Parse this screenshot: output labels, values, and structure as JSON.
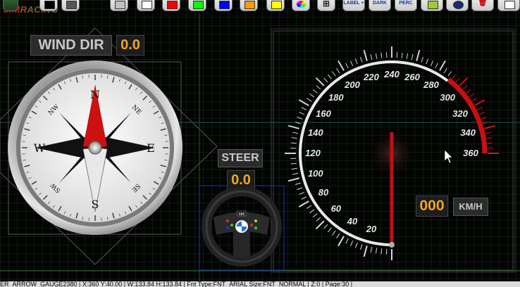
{
  "toolbar": {
    "brand": "SIMRACING",
    "color_swatches": [
      "#000000",
      "#555555",
      "#c0c0c0",
      "#ffffff",
      "#ff0000",
      "#00ff00",
      "#0000ff",
      "#ff9900",
      "#ffff00"
    ],
    "label_button": "LABEL +",
    "dark_button": "DARK",
    "perc_button": "PERC"
  },
  "wind_dir": {
    "label": "WIND DIR",
    "value": "0.0"
  },
  "steer": {
    "label": "STEER",
    "value": "0.0"
  },
  "speedo": {
    "speed_value": "000",
    "unit": "KM/H",
    "ticks": [
      "20",
      "40",
      "60",
      "80",
      "100",
      "120",
      "140",
      "160",
      "180",
      "200",
      "220",
      "240",
      "260",
      "280",
      "300",
      "320",
      "340",
      "360"
    ],
    "redline_from": 290
  },
  "compass": {
    "cardinals": [
      "N",
      "E",
      "S",
      "W"
    ],
    "intercardinals": [
      "NE",
      "SE",
      "SW",
      "NW"
    ]
  },
  "statusbar": {
    "text": "ER_ARROW_GAUGE2380 | X:360 Y:40.00 | W:133.84 H:133.84 | Fnt Type:FNT_ARIAL Size:FNT_NORMAL | Z:0 | Page:30 |"
  }
}
